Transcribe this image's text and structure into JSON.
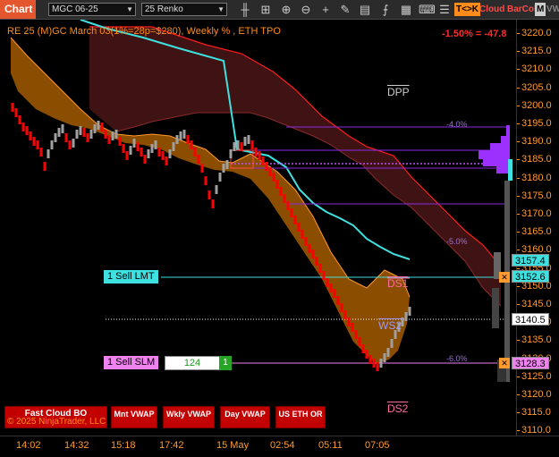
{
  "toolbar": {
    "chart_tab": "Chart",
    "instrument": "MGC 06-25",
    "bar_type": "25 Renko",
    "btn_tk": "T<>K",
    "btn_cloud": "Cloud",
    "btn_barcol": "BarCol",
    "btn_m": "M",
    "btn_vww": "VWW"
  },
  "chart": {
    "header": "RE 25 (M)GC March 03(1%=28p=$280), Weekly % , ETH TPO",
    "pl": "-1.50% = -47.8",
    "dpp": "DPP",
    "ds1": "DS1",
    "ws2": "WS2",
    "ds2": "DS2",
    "pct_4": "-4.0%",
    "pct_5": "-5.0%",
    "pct_6": "-6.0%"
  },
  "orders": {
    "sell_lmt": "1 Sell LMT",
    "sell_slm": "1 Sell SLM",
    "qty": "124",
    "qty_side": "1"
  },
  "price_tags": {
    "p1": "3157.4",
    "p2": "3152.6",
    "p3": "3140.5",
    "p4": "3128.3"
  },
  "buttons": {
    "fast_cloud": "Fast Cloud BO",
    "mnt_vwap": "Mnt VWAP",
    "wkly_vwap": "Wkly VWAP",
    "day_vwap": "Day VWAP",
    "us_eth_or": "US ETH OR"
  },
  "copyright": "© 2025 NinjaTrader, LLC",
  "price_axis": [
    "3220.0",
    "3215.0",
    "3210.0",
    "3205.0",
    "3200.0",
    "3195.0",
    "3190.0",
    "3185.0",
    "3180.0",
    "3175.0",
    "3170.0",
    "3165.0",
    "3160.0",
    "3155.0",
    "3150.0",
    "3145.0",
    "3140.0",
    "3135.0",
    "3130.0",
    "3125.0",
    "3120.0",
    "3115.0",
    "3110.0"
  ],
  "time_axis": [
    "14:02",
    "14:32",
    "15:18",
    "17:42",
    "15 May",
    "02:54",
    "05:11",
    "07:05"
  ],
  "colors": {
    "bull": "#a0a0a0",
    "bear": "#ff0000",
    "cloud_up": "#a35a00",
    "cloud_down": "#4a1616",
    "vwap": "#3fe0e0",
    "tpo": "#9b30ff",
    "accent": "#ff8c1a"
  }
}
